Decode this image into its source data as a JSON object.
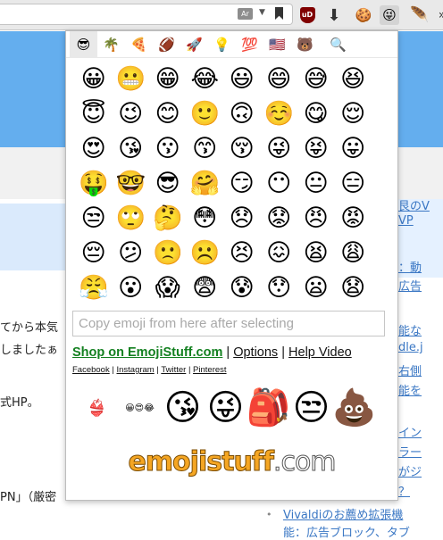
{
  "toolbar": {
    "reader_label": "Ar",
    "extensions": [
      {
        "name": "ublock-origin",
        "label": "uD"
      },
      {
        "name": "download",
        "icon": "⬇"
      },
      {
        "name": "cookie",
        "icon": "🍪"
      },
      {
        "name": "emoji",
        "icon": "😜"
      },
      {
        "name": "feather",
        "icon": "🪶"
      },
      {
        "name": "overflow",
        "icon": "»"
      }
    ]
  },
  "page": {
    "left_lines": [
      "てから本気",
      "しましたぁ",
      "式HP。",
      "PN」（厳密"
    ],
    "right_links": [
      "艮のV",
      "VP",
      "：動",
      "広告",
      "能な",
      "dle.j",
      "右側",
      "能を",
      "イン",
      "ラー",
      "がジ",
      "？"
    ],
    "bottom_links": [
      "Vivaldiのお薦め拡張機",
      "能：広告ブロック、タブ"
    ],
    "bullet": "•"
  },
  "popup": {
    "categories": [
      "😎",
      "🌴",
      "🍕",
      "🏈",
      "🚀",
      "💡",
      "💯",
      "🇺🇸",
      "🐻",
      "🔍"
    ],
    "active_category": 0,
    "emojis": [
      "😀",
      "😬",
      "😁",
      "😂",
      "😃",
      "😄",
      "😅",
      "😆",
      "😇",
      "😉",
      "😊",
      "🙂",
      "🙃",
      "☺️",
      "😋",
      "😌",
      "😍",
      "😘",
      "😗",
      "😙",
      "😚",
      "😜",
      "😝",
      "😛",
      "🤑",
      "🤓",
      "😎",
      "🤗",
      "😏",
      "😶",
      "😐",
      "😑",
      "😒",
      "🙄",
      "🤔",
      "😳",
      "😞",
      "😟",
      "😠",
      "😡",
      "😔",
      "😕",
      "🙁",
      "☹️",
      "😣",
      "😖",
      "😫",
      "😩",
      "😤",
      "😮",
      "😱",
      "😨",
      "😰",
      "😯",
      "😦",
      "😧"
    ],
    "copy_placeholder": "Copy emoji from here after selecting",
    "links": {
      "shop": "Shop on EmojiStuff.com",
      "options": "Options",
      "help": "Help Video",
      "separator": "|"
    },
    "social": [
      "Facebook",
      "Instagram",
      "Twitter",
      "Pinterest"
    ],
    "social_separator": "|",
    "products": [
      {
        "name": "emoji-swimsuit",
        "icon": "👙"
      },
      {
        "name": "emoji-collage",
        "icon": "😀😍😂"
      },
      {
        "name": "kissing-pillow",
        "icon": "😘"
      },
      {
        "name": "winking-tongue-pillow",
        "icon": "😜"
      },
      {
        "name": "emoji-backpack",
        "icon": "🎒"
      },
      {
        "name": "unamused-pillow",
        "icon": "😒"
      },
      {
        "name": "poop-pillow",
        "icon": "💩"
      }
    ],
    "logo": {
      "part1": "emoj",
      "part2": "i",
      "part3": "stuff",
      "part4": ".com"
    }
  }
}
